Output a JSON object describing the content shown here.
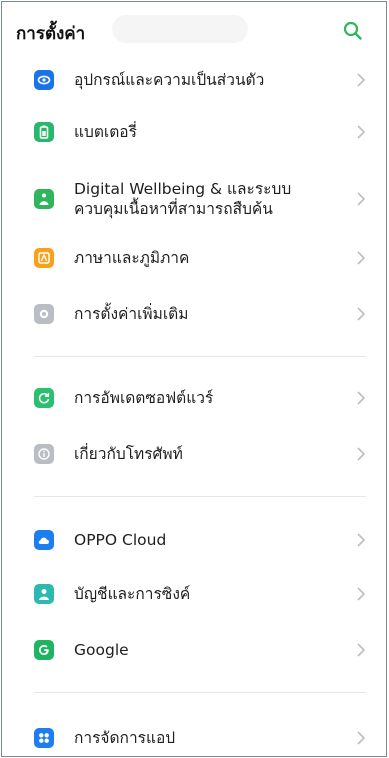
{
  "header": {
    "title": "การตั้งค่า"
  },
  "colors": {
    "accent": "#2fb55c",
    "privacy": "#1a73e8",
    "battery": "#27b86b",
    "wellbeing": "#2fb55c",
    "language": "#f7a21b",
    "more": "#b9bec4",
    "update": "#2bbf70",
    "about": "#b9bec4",
    "cloud": "#1c7ef0",
    "accounts": "#2bb9b0",
    "google": "#1fb463",
    "apps": "#1c7ef0"
  },
  "items": [
    {
      "label": "อุปกรณ์และความเป็นส่วนตัว",
      "icon": "privacy-icon"
    },
    {
      "label": "แบตเตอรี่",
      "icon": "battery-icon"
    },
    {
      "label": "Digital Wellbeing & และระบบควบคุมเนื้อหาที่สามารถสืบค้น",
      "icon": "wellbeing-icon"
    },
    {
      "label": "ภาษาและภูมิภาค",
      "icon": "language-icon"
    },
    {
      "label": "การตั้งค่าเพิ่มเติม",
      "icon": "more-settings-icon"
    },
    {
      "label": "การอัพเดตซอฟต์แวร์",
      "icon": "update-icon"
    },
    {
      "label": "เกี่ยวกับโทรศัพท์",
      "icon": "about-icon"
    },
    {
      "label": "OPPO Cloud",
      "icon": "cloud-icon"
    },
    {
      "label": "บัญชีและการซิงค์",
      "icon": "accounts-icon"
    },
    {
      "label": "Google",
      "icon": "google-icon"
    },
    {
      "label": "การจัดการแอป",
      "icon": "apps-icon"
    }
  ]
}
